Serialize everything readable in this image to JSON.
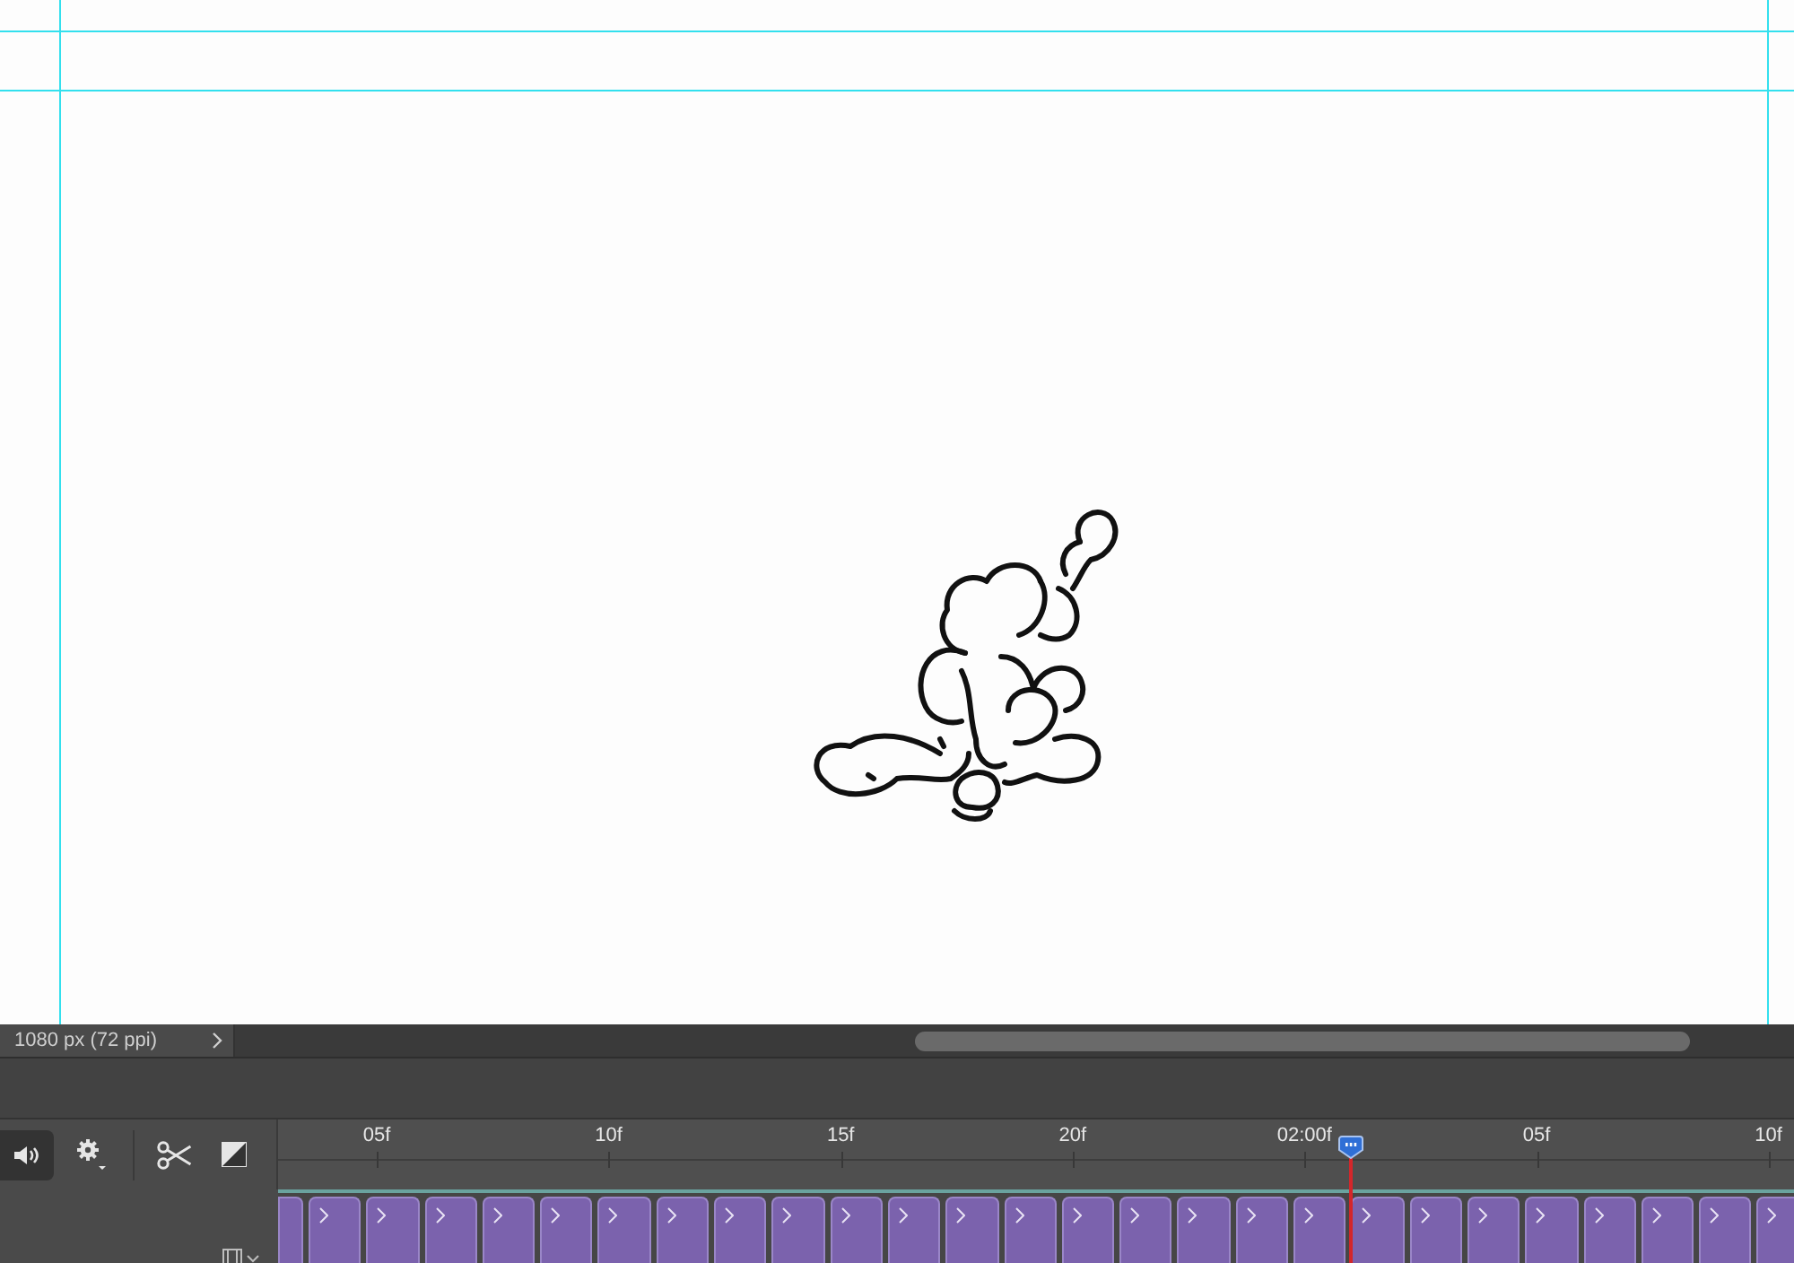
{
  "status_bar": {
    "document_info": "1080 px (72 ppi)"
  },
  "timeline": {
    "ruler_labels": [
      "05f",
      "10f",
      "15f",
      "20f",
      "02:00f",
      "05f",
      "10f"
    ]
  }
}
